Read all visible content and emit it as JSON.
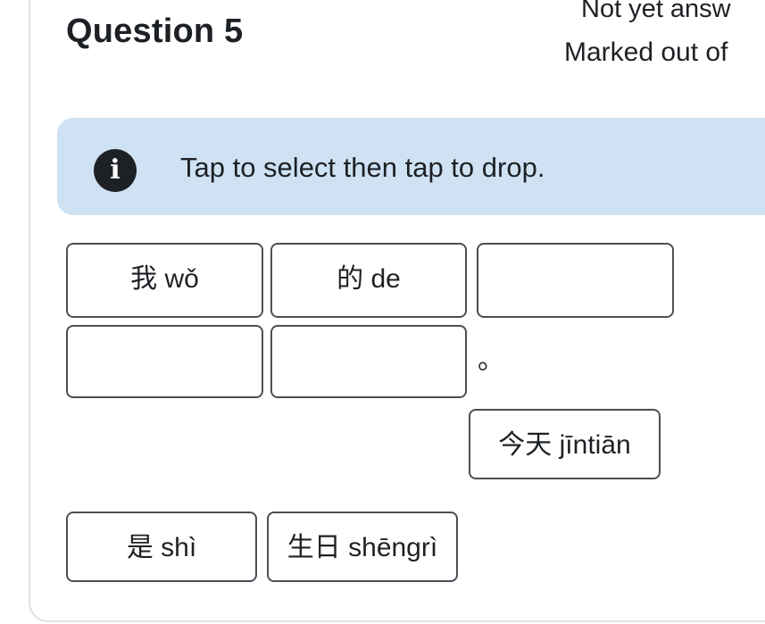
{
  "question": {
    "title": "Question 5",
    "status": "Not yet answ",
    "marks": "Marked out of"
  },
  "info": {
    "icon": "info-icon",
    "icon_glyph": "i",
    "text": "Tap to select then tap to drop."
  },
  "sentence": {
    "filled": [
      {
        "text": "我 wǒ"
      },
      {
        "text": "的 de"
      }
    ],
    "punctuation": "。"
  },
  "choices": [
    {
      "text": "今天 jīntiān"
    },
    {
      "text": "是 shì"
    },
    {
      "text": "生日 shēngrì"
    }
  ],
  "colors": {
    "info_background": "#cfe2f3",
    "box_border": "#495057",
    "card_border": "#dee2e6",
    "text": "#1d2125"
  }
}
